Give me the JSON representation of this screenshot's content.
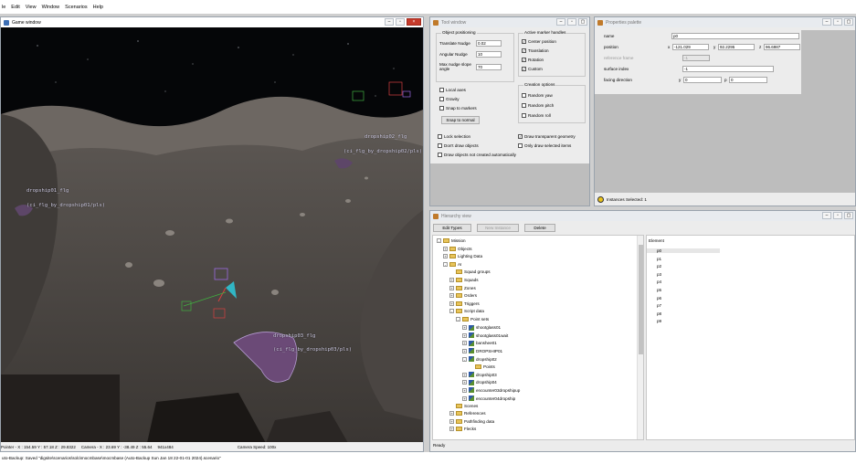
{
  "menu": [
    "le",
    "Edit",
    "View",
    "Window",
    "Scenarios",
    "Help"
  ],
  "game_window": {
    "title": "Game window",
    "labels": [
      {
        "text": "dropship02_flg",
        "sub": "(ci_flg_by_dropship02/pls)"
      },
      {
        "text": "dropship01_flg",
        "sub": "(ci_flg_by_dropship01/pls)"
      },
      {
        "text": "dropship03_flg",
        "sub": "(ci_flg_by_dropship03/pls)"
      }
    ],
    "status": {
      "pointer": "Pointer - X : 154.59  Y : 57.18  Z : 29.8322",
      "camera": "Camera - X : 23.69  Y : -38.49  Z : 55.64",
      "resolution": "941x484",
      "speed": "Camera Speed: 100x"
    }
  },
  "tool_window": {
    "title": "Tool window",
    "object_positioning": {
      "title": "Object positioning",
      "translate_label": "Translate Nudge",
      "translate_value": "0.02",
      "angular_label": "Angular Nudge",
      "angular_value": "10",
      "max_nudge_label": "Max nudge slope angle",
      "max_nudge_value": "70"
    },
    "active_handles": {
      "title": "Active marker handles",
      "items": [
        {
          "label": "Center position",
          "checked": true
        },
        {
          "label": "Translation",
          "checked": true
        },
        {
          "label": "Rotation",
          "checked": true
        },
        {
          "label": "Custom",
          "checked": true
        }
      ]
    },
    "axes_items": [
      {
        "label": "Local axes",
        "checked": false
      },
      {
        "label": "Gravity",
        "checked": false
      },
      {
        "label": "Snap to markers",
        "checked": false
      }
    ],
    "snap_button": "Snap to normal",
    "creation_options": {
      "title": "Creation options",
      "items": [
        {
          "label": "Random yaw",
          "checked": false
        },
        {
          "label": "Random pitch",
          "checked": false
        },
        {
          "label": "Random roll",
          "checked": false
        }
      ]
    },
    "bottom_left": [
      {
        "label": "Lock selection",
        "checked": false
      },
      {
        "label": "Don't draw objects",
        "checked": false
      },
      {
        "label": "Draw objects not created automatically",
        "checked": false
      }
    ],
    "bottom_right": [
      {
        "label": "Draw transparent geometry",
        "checked": true
      },
      {
        "label": "Only draw selected items",
        "checked": false
      }
    ]
  },
  "properties": {
    "title": "Properties palette",
    "name_label": "name",
    "name_value": "p0",
    "position_label": "position",
    "pos_x": "-121.029",
    "pos_y": "92.2295",
    "pos_z": "96.6987",
    "reference_frame_label": "reference frame",
    "reference_frame_value": "-1",
    "surface_index_label": "surface index",
    "surface_index_value": "-1",
    "facing_label": "facing direction",
    "facing_y": "0",
    "facing_p": "0",
    "instances": "Instances Selected: 1"
  },
  "hierarchy": {
    "title": "Hierarchy view",
    "buttons": {
      "edit_types": "Edit Types",
      "new_instance": "New Instance",
      "delete": "Delete"
    },
    "tree": [
      {
        "label": "Mission",
        "indent": 0,
        "kind": "folder",
        "exp": "-"
      },
      {
        "label": "Objects",
        "indent": 1,
        "kind": "folder",
        "exp": "+"
      },
      {
        "label": "Lighting Data",
        "indent": 1,
        "kind": "folder",
        "exp": "+"
      },
      {
        "label": "AI",
        "indent": 1,
        "kind": "folder",
        "exp": "-"
      },
      {
        "label": "Squad groups",
        "indent": 2,
        "kind": "folder",
        "exp": ""
      },
      {
        "label": "Squads",
        "indent": 2,
        "kind": "folder",
        "exp": "+"
      },
      {
        "label": "Zones",
        "indent": 2,
        "kind": "folder",
        "exp": "+"
      },
      {
        "label": "Orders",
        "indent": 2,
        "kind": "folder",
        "exp": "+"
      },
      {
        "label": "Triggers",
        "indent": 2,
        "kind": "folder",
        "exp": "+"
      },
      {
        "label": "Script data",
        "indent": 2,
        "kind": "folder",
        "exp": "-"
      },
      {
        "label": "Point sets",
        "indent": 3,
        "kind": "folder",
        "exp": "-"
      },
      {
        "label": "shootglass01",
        "indent": 4,
        "kind": "script",
        "exp": "+"
      },
      {
        "label": "shootglass01wait",
        "indent": 4,
        "kind": "script",
        "exp": "+"
      },
      {
        "label": "banshee01",
        "indent": 4,
        "kind": "script",
        "exp": "+"
      },
      {
        "label": "DROPSHIP01",
        "indent": 4,
        "kind": "script",
        "exp": "+"
      },
      {
        "label": "dropship02",
        "indent": 4,
        "kind": "script",
        "exp": "-"
      },
      {
        "label": "Points",
        "indent": 5,
        "kind": "folder",
        "exp": ""
      },
      {
        "label": "dropship03",
        "indent": 4,
        "kind": "script",
        "exp": "+"
      },
      {
        "label": "dropship04",
        "indent": 4,
        "kind": "script",
        "exp": "+"
      },
      {
        "label": "encounter03dropshipup",
        "indent": 4,
        "kind": "script",
        "exp": "+"
      },
      {
        "label": "encounter04dropship",
        "indent": 4,
        "kind": "script",
        "exp": "+"
      },
      {
        "label": "Scenes",
        "indent": 2,
        "kind": "folder",
        "exp": ""
      },
      {
        "label": "References",
        "indent": 2,
        "kind": "folder",
        "exp": "+"
      },
      {
        "label": "Pathfinding data",
        "indent": 2,
        "kind": "folder",
        "exp": "+"
      },
      {
        "label": "Flecks",
        "indent": 2,
        "kind": "folder",
        "exp": "+"
      }
    ],
    "element_header": "Element",
    "elements": [
      "p0",
      "p1",
      "p2",
      "p3",
      "p4",
      "p5",
      "p6",
      "p7",
      "p8",
      "p9"
    ],
    "status": "Ready"
  },
  "bottom_status": "uto-Backup: Saved \"digsite\\scenarios\\solo\\mocmbase\\mocmbase (Auto-Backup Sun Jan 18 22-01-01 2024).scenario\""
}
